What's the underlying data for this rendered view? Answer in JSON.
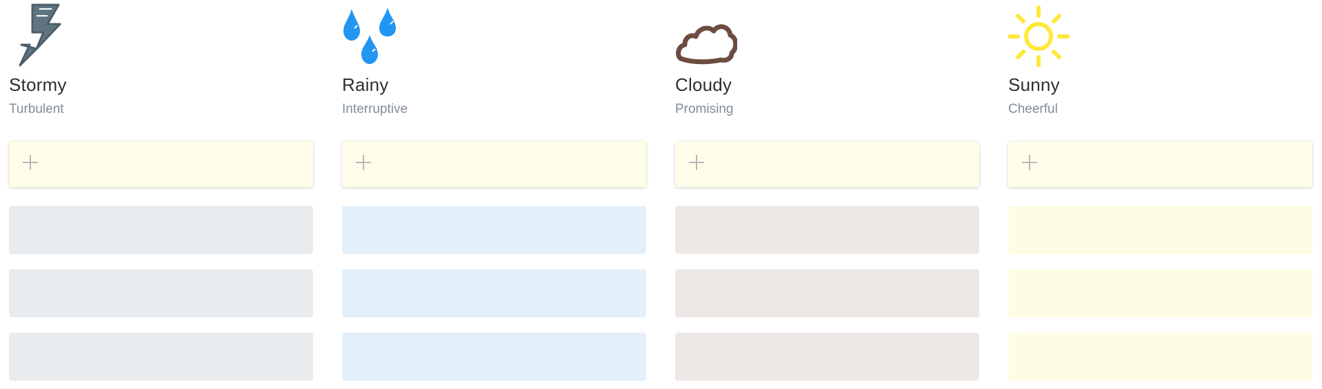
{
  "columns": [
    {
      "title": "Stormy",
      "subtitle": "Turbulent",
      "icon": "lightning-icon",
      "icon_color": "#5f7480",
      "card_color": "#e9ecee",
      "cards": [
        "",
        "",
        ""
      ]
    },
    {
      "title": "Rainy",
      "subtitle": "Interruptive",
      "icon": "raindrops-icon",
      "icon_color": "#2196f3",
      "card_color": "#e3f0fb",
      "cards": [
        "",
        "",
        ""
      ]
    },
    {
      "title": "Cloudy",
      "subtitle": "Promising",
      "icon": "cloud-icon",
      "icon_color": "#6d4c41",
      "card_color": "#ede8e5",
      "cards": [
        "",
        "",
        ""
      ]
    },
    {
      "title": "Sunny",
      "subtitle": "Cheerful",
      "icon": "sun-icon",
      "icon_color": "#ffe83a",
      "card_color": "#fffce5",
      "cards": [
        "",
        "",
        ""
      ]
    }
  ],
  "add_card_color": "#fffde9",
  "add_icon": "plus-icon"
}
